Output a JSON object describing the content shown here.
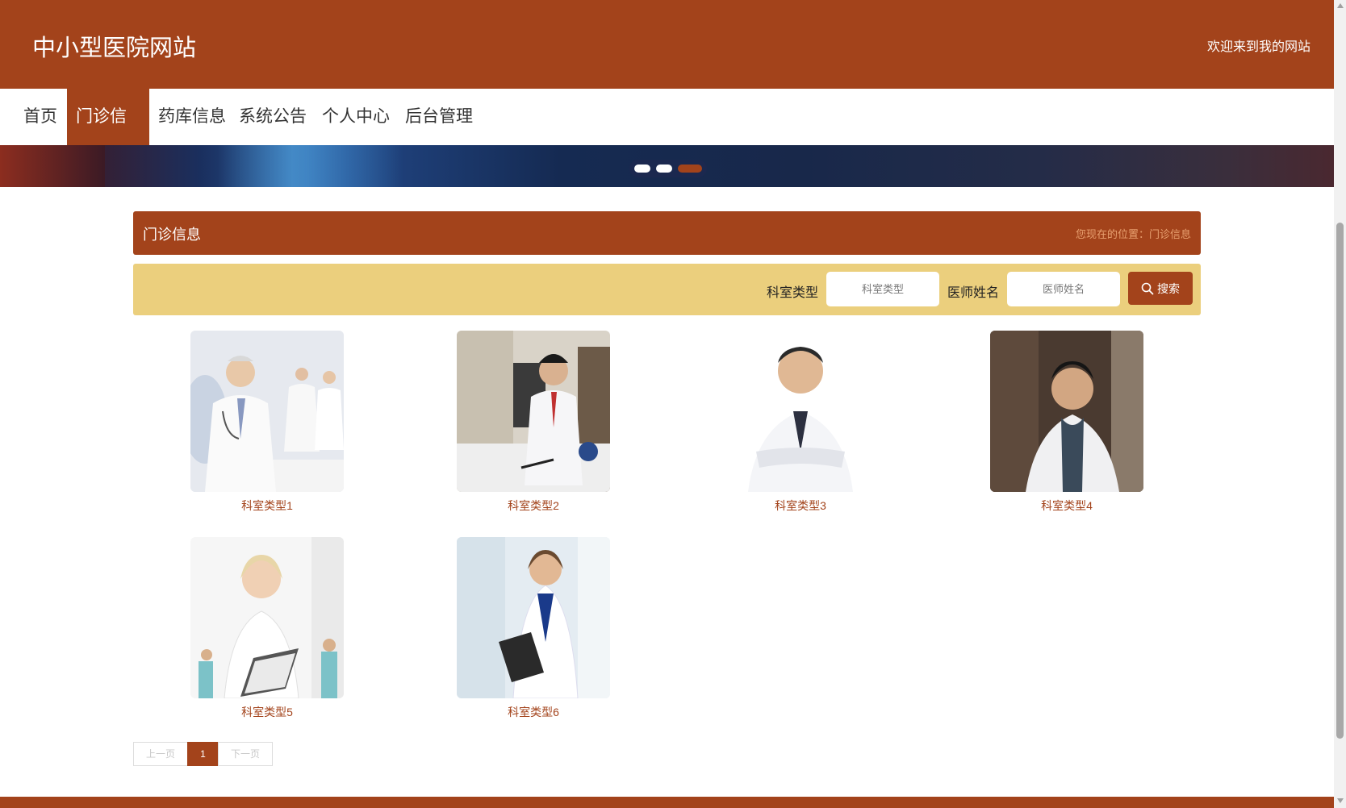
{
  "header": {
    "site_title": "中小型医院网站",
    "welcome_text": "欢迎来到我的网站"
  },
  "nav": {
    "items": [
      {
        "label": "首页"
      },
      {
        "label": "门诊信息"
      },
      {
        "label": "药库信息"
      },
      {
        "label": "系统公告"
      },
      {
        "label": "个人中心"
      },
      {
        "label": "后台管理"
      }
    ],
    "active": "门诊信息"
  },
  "banner": {
    "slides": 3,
    "active_slide": 3
  },
  "section": {
    "title": "门诊信息",
    "location": "您现在的位置：门诊信息"
  },
  "search": {
    "dept_label": "科室类型",
    "dept_placeholder": "科室类型",
    "doctor_label": "医师姓名",
    "doctor_placeholder": "医师姓名",
    "button_label": "搜索"
  },
  "cards": [
    {
      "label": "科室类型1"
    },
    {
      "label": "科室类型2"
    },
    {
      "label": "科室类型3"
    },
    {
      "label": "科室类型4"
    },
    {
      "label": "科室类型5"
    },
    {
      "label": "科室类型6"
    }
  ],
  "pagination": {
    "prev_label": "上一页",
    "current_page": "1",
    "next_label": "下一页"
  },
  "colors": {
    "primary": "#a3431b",
    "search_bar": "#ebcf7d"
  }
}
